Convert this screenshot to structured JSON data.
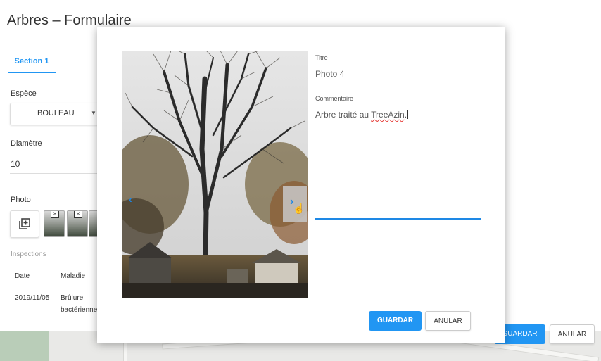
{
  "page": {
    "title": "Arbres – Formulaire"
  },
  "tabs": [
    {
      "label": "Section 1",
      "active": true
    }
  ],
  "form": {
    "espece": {
      "label": "Espèce",
      "value": "BOULEAU"
    },
    "diametre": {
      "label": "Diamètre",
      "value": "10"
    },
    "photo": {
      "label": "Photo",
      "thumbnails_visible": 3
    },
    "inspections": {
      "label": "Inspections",
      "columns": [
        "Date",
        "Maladie"
      ],
      "rows": [
        {
          "date": "2019/11/05",
          "maladie_line1": "Brûlure",
          "maladie_line2": "bactérienne"
        }
      ]
    }
  },
  "background_actions": {
    "save_label": "GUARDAR",
    "cancel_label": "ANULAR"
  },
  "dialog": {
    "titre_label": "Titre",
    "titre_value": "Photo 4",
    "commentaire_label": "Commentaire",
    "commentaire_prefix": "Arbre traité au ",
    "commentaire_highlight": "TreeAzin",
    "commentaire_suffix": ".",
    "save_label": "GUARDAR",
    "cancel_label": "ANULAR"
  },
  "colors": {
    "accent": "#2196f3",
    "text": "#333333",
    "muted": "#9a9a9a"
  },
  "icons": {
    "add_photo": "add-photo-icon",
    "next": "chevron-right-icon",
    "prev": "chevron-left-icon",
    "cursor": "hand-pointer-icon",
    "remove": "close-icon"
  }
}
